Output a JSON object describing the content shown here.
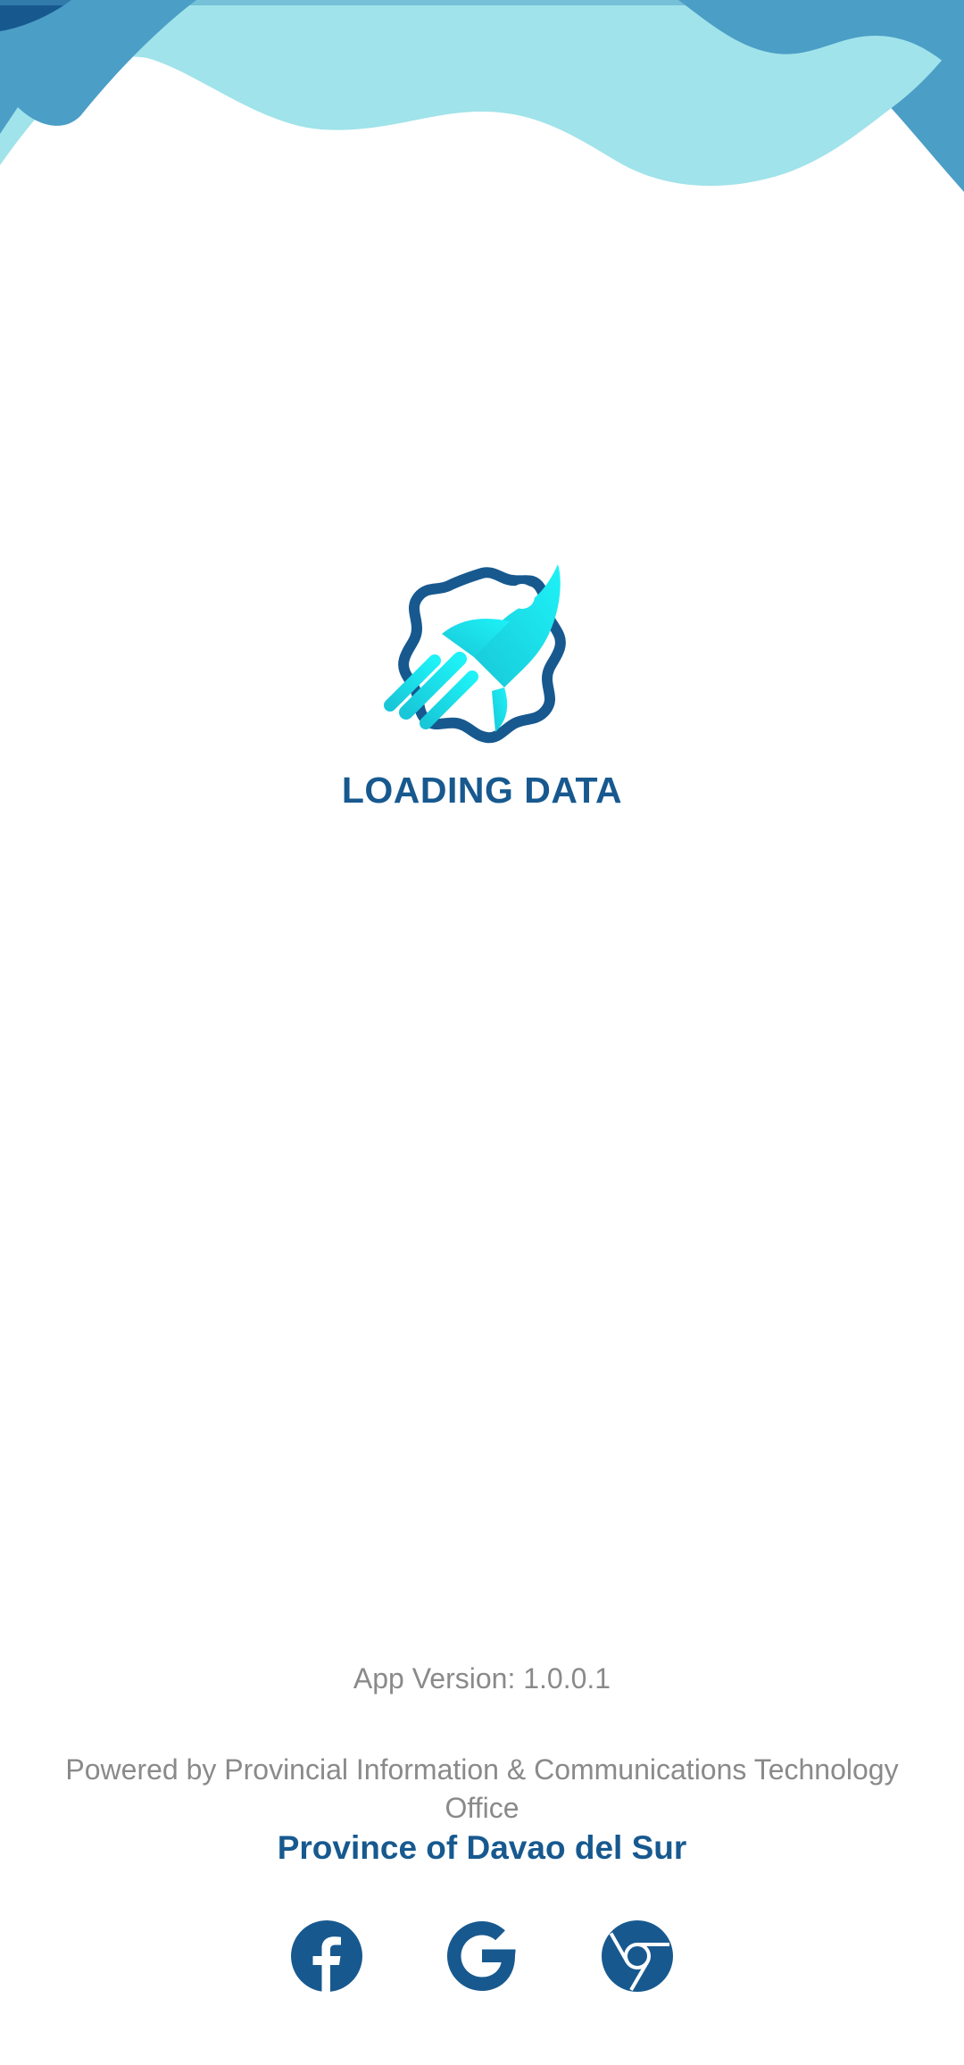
{
  "loading": {
    "title": "LOADING DATA"
  },
  "footer": {
    "app_version": "App Version: 1.0.0.1",
    "powered_by": "Powered by Provincial Information & Communications Technology Office",
    "province": "Province of Davao del Sur"
  },
  "social": [
    {
      "icon": "facebook-icon"
    },
    {
      "icon": "google-icon"
    },
    {
      "icon": "chrome-icon"
    }
  ],
  "colors": {
    "brand_dark": "#17598f",
    "wave_mid": "#4b9ec6",
    "wave_light": "#a0e3ea",
    "rocket_cyan": "#18e6f2",
    "muted_text": "#8a8a8a"
  }
}
